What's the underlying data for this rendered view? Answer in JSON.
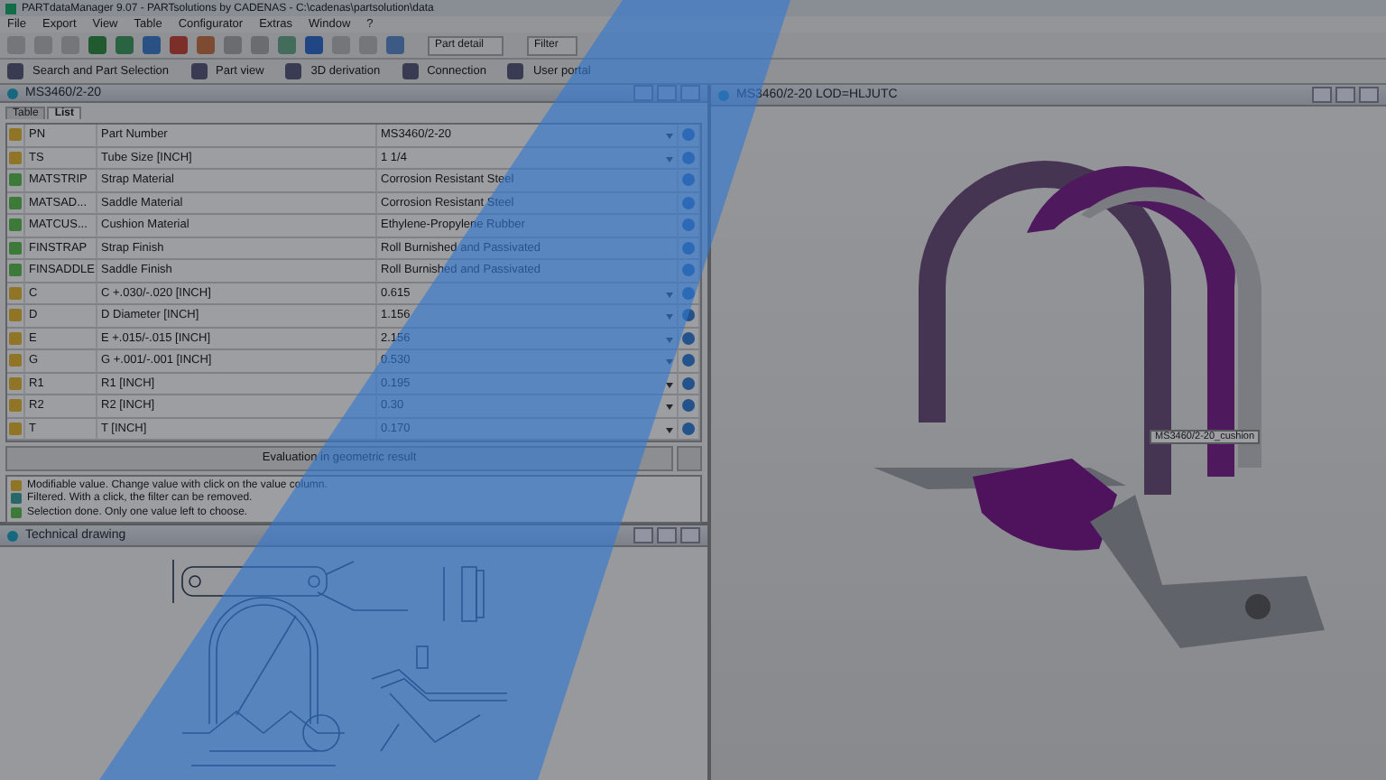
{
  "window": {
    "title": "PARTdataManager 9.07 - PARTsolutions by CADENAS - C:\\cadenas\\partsolution\\data"
  },
  "menu": [
    "File",
    "Export",
    "View",
    "Table",
    "Configurator",
    "Extras",
    "Window",
    "?"
  ],
  "toolbar": {
    "dropdowns": [
      "Part detail",
      "Filter"
    ]
  },
  "view_toolbar": [
    "Search and Part Selection",
    "Part view",
    "3D derivation",
    "Connection",
    "User portal"
  ],
  "part_panel": {
    "title": "MS3460/2-20",
    "tabs": [
      {
        "label": "Table",
        "selected": false
      },
      {
        "label": "List",
        "selected": true
      }
    ],
    "rows": [
      {
        "kind": "modifiable",
        "key": "PN",
        "name": "Part Number",
        "value": "MS3460/2-20"
      },
      {
        "kind": "modifiable",
        "key": "TS",
        "name": "Tube Size [INCH]",
        "value": "1 1/4"
      },
      {
        "kind": "done",
        "key": "MATSTRIP",
        "name": "Strap Material",
        "value": "Corrosion Resistant Steel"
      },
      {
        "kind": "done",
        "key": "MATSAD...",
        "name": "Saddle Material",
        "value": "Corrosion Resistant Steel"
      },
      {
        "kind": "done",
        "key": "MATCUS...",
        "name": "Cushion Material",
        "value": "Ethylene-Propylene Rubber"
      },
      {
        "kind": "done",
        "key": "FINSTRAP",
        "name": "Strap Finish",
        "value": "Roll Burnished and Passivated"
      },
      {
        "kind": "done",
        "key": "FINSADDLE",
        "name": "Saddle Finish",
        "value": "Roll Burnished and Passivated"
      },
      {
        "kind": "modifiable",
        "key": "C",
        "name": "C +.030/-.020 [INCH]",
        "value": "0.615"
      },
      {
        "kind": "modifiable",
        "key": "D",
        "name": "D Diameter [INCH]",
        "value": "1.156"
      },
      {
        "kind": "modifiable",
        "key": "E",
        "name": "E +.015/-.015 [INCH]",
        "value": "2.156"
      },
      {
        "kind": "modifiable",
        "key": "G",
        "name": "G +.001/-.001 [INCH]",
        "value": "0.530"
      },
      {
        "kind": "modifiable",
        "key": "R1",
        "name": "R1 [INCH]",
        "value": "0.195"
      },
      {
        "kind": "modifiable",
        "key": "R2",
        "name": "R2 [INCH]",
        "value": "0.30"
      },
      {
        "kind": "modifiable",
        "key": "T",
        "name": "T [INCH]",
        "value": "0.170"
      }
    ],
    "evaluate_button": "Evaluation in geometric result",
    "legend": [
      {
        "kind": "modifiable",
        "text": "Modifiable value. Change value with click on the value column."
      },
      {
        "kind": "filtered",
        "text": "Filtered. With a click, the filter can be removed."
      },
      {
        "kind": "done",
        "text": "Selection done. Only one value left to choose."
      }
    ]
  },
  "drawing_panel": {
    "title": "Technical drawing"
  },
  "view_panel": {
    "title": "MS3460/2-20 LOD=HLJUTC",
    "tooltip": "MS3460/2-20_cushion"
  }
}
